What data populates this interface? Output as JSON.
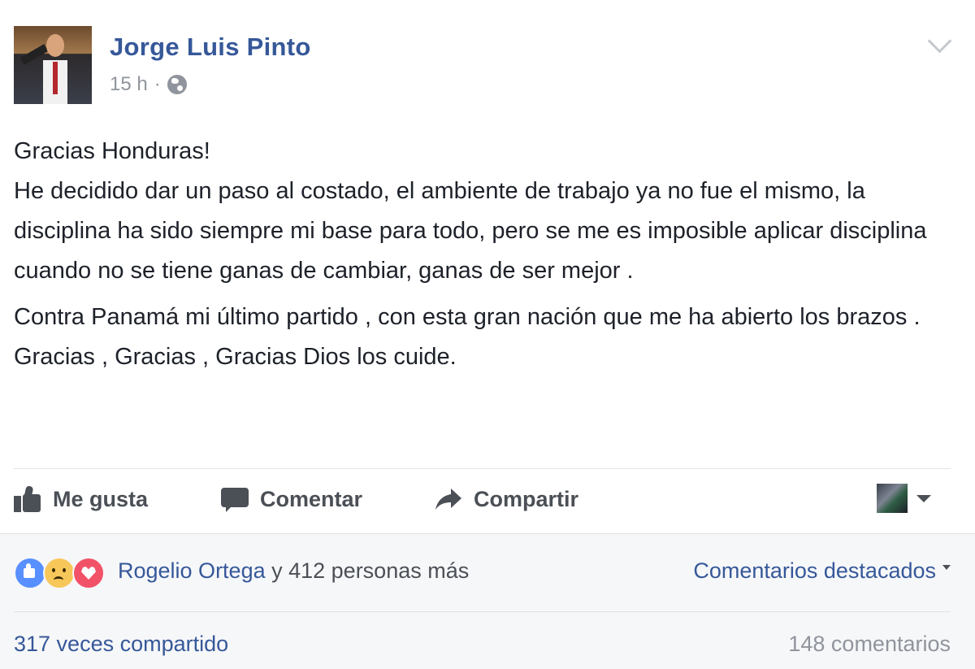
{
  "post": {
    "author": "Jorge Luis Pinto",
    "time": "15 h",
    "separator": "·",
    "privacy_icon": "globe-icon",
    "paragraphs": [
      "Gracias Honduras!",
      "He decidido dar un paso al costado, el ambiente de trabajo ya no fue el mismo, la disciplina ha sido siempre mi base para todo, pero se me es imposible aplicar disciplina cuando no se tiene ganas de cambiar, ganas de ser mejor .",
      "Contra Panamá mi último partido , con esta gran nación que me ha abierto los brazos .",
      "Gracias , Gracias , Gracias Dios los cuide."
    ]
  },
  "actions": {
    "like": "Me gusta",
    "comment": "Comentar",
    "share": "Compartir"
  },
  "reactions": {
    "icons": [
      "like-reaction",
      "sad-reaction",
      "love-reaction"
    ],
    "name": "Rogelio Ortega",
    "rest": " y 412 personas más"
  },
  "featured_comments": "Comentarios destacados",
  "shares": "317 veces compartido",
  "comments": "148 comentarios",
  "colors": {
    "link_blue": "#365899",
    "text": "#1d2129",
    "muted": "#90949c",
    "action_gray": "#4b4f56",
    "footer_bg": "#f6f7f9"
  }
}
